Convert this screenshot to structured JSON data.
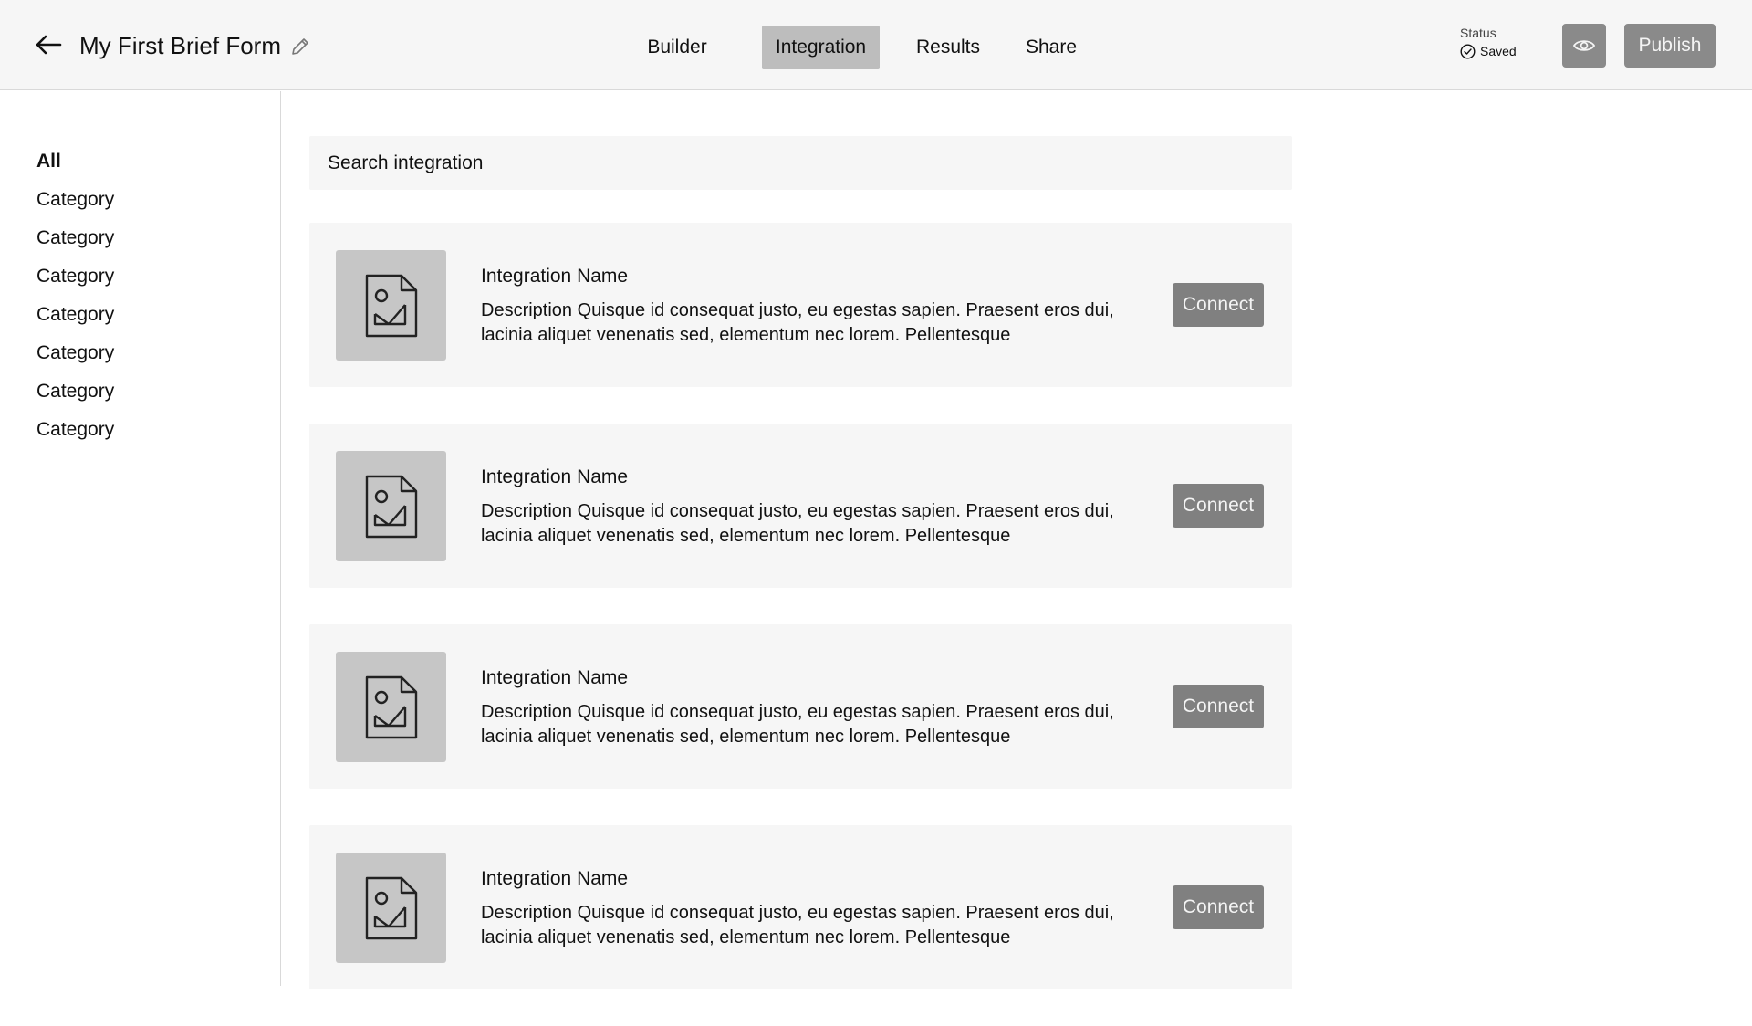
{
  "header": {
    "back_icon": "arrow-left-icon",
    "title": "My First Brief Form",
    "edit_icon": "pencil-icon",
    "tabs": [
      {
        "label": "Builder",
        "active": false
      },
      {
        "label": "Integration",
        "active": true
      },
      {
        "label": "Results",
        "active": false
      },
      {
        "label": "Share",
        "active": false
      }
    ],
    "status": {
      "label": "Status",
      "value": "Saved",
      "icon": "check-circle-icon"
    },
    "preview_icon": "eye-icon",
    "publish_label": "Publish"
  },
  "sidebar": {
    "categories": [
      {
        "label": "All",
        "active": true
      },
      {
        "label": "Category",
        "active": false
      },
      {
        "label": "Category",
        "active": false
      },
      {
        "label": "Category",
        "active": false
      },
      {
        "label": "Category",
        "active": false
      },
      {
        "label": "Category",
        "active": false
      },
      {
        "label": "Category",
        "active": false
      },
      {
        "label": "Category",
        "active": false
      }
    ]
  },
  "search": {
    "placeholder": "Search integration"
  },
  "integrations": [
    {
      "icon": "image-file-icon",
      "name": "Integration Name",
      "description": "Description Quisque id consequat justo, eu egestas sapien. Praesent eros dui, lacinia aliquet venenatis sed, elementum nec lorem. Pellentesque",
      "action_label": "Connect"
    },
    {
      "icon": "image-file-icon",
      "name": "Integration Name",
      "description": "Description Quisque id consequat justo, eu egestas sapien. Praesent eros dui, lacinia aliquet venenatis sed, elementum nec lorem. Pellentesque",
      "action_label": "Connect"
    },
    {
      "icon": "image-file-icon",
      "name": "Integration Name",
      "description": "Description Quisque id consequat justo, eu egestas sapien. Praesent eros dui, lacinia aliquet venenatis sed, elementum nec lorem. Pellentesque",
      "action_label": "Connect"
    },
    {
      "icon": "image-file-icon",
      "name": "Integration Name",
      "description": "Description Quisque id consequat justo, eu egestas sapien. Praesent eros dui, lacinia aliquet venenatis sed, elementum nec lorem. Pellentesque",
      "action_label": "Connect"
    }
  ],
  "colors": {
    "header_bg": "#f6f6f6",
    "card_bg": "#f6f6f6",
    "active_tab_bg": "#bdbdbd",
    "button_bg": "#808080",
    "thumb_bg": "#c6c6c6"
  }
}
